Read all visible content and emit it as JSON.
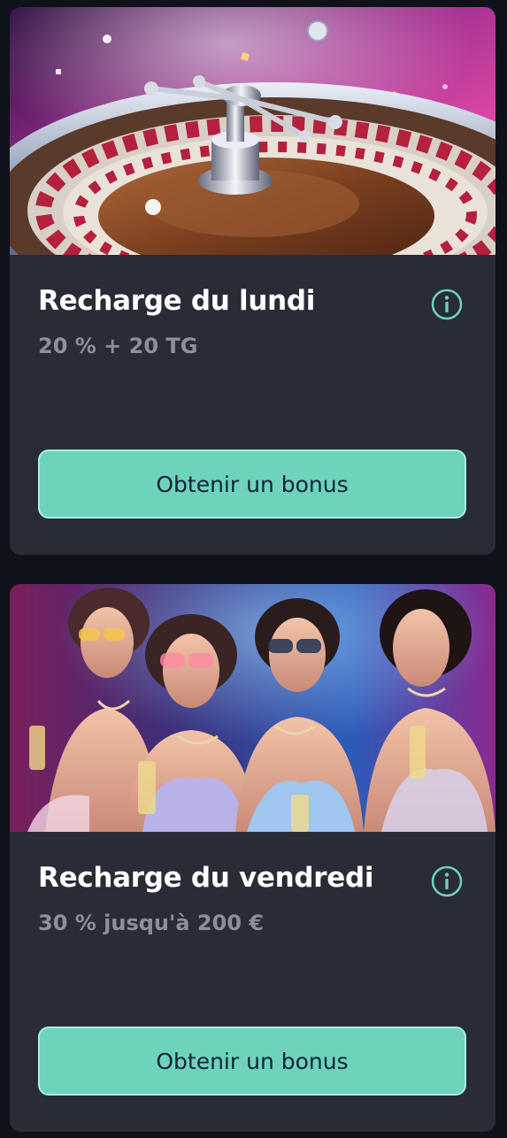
{
  "colors": {
    "page_background": "#0f1218",
    "card_background": "#292b37",
    "title_text": "#ffffff",
    "subtitle_text": "#8c8f9c",
    "accent": "#6dd3bb",
    "button_text": "#13233a"
  },
  "offers": [
    {
      "title": "Recharge du lundi",
      "subtitle": "20 % + 20 TG",
      "button_label": "Obtenir un bonus",
      "icon": "info-icon",
      "image": "roulette-wheel"
    },
    {
      "title": "Recharge du vendredi",
      "subtitle": "30 % jusqu'à 200 €",
      "button_label": "Obtenir un bonus",
      "icon": "info-icon",
      "image": "party-women-champagne"
    }
  ]
}
